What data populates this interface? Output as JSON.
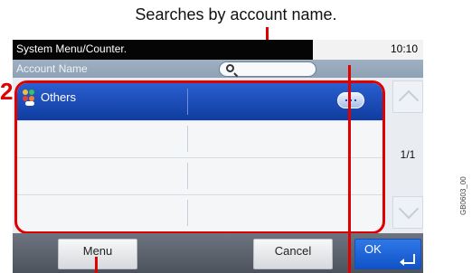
{
  "caption": "Searches by account name.",
  "window": {
    "title": "System Menu/Counter.",
    "time": "10:10",
    "header_label": "Account Name"
  },
  "search": {
    "placeholder": ""
  },
  "step_number": "2",
  "rows": [
    {
      "name": "Others",
      "selected": true,
      "has_more_button": true
    },
    {
      "name": "",
      "selected": false
    },
    {
      "name": "",
      "selected": false
    },
    {
      "name": "",
      "selected": false
    }
  ],
  "pager": {
    "label": "1/1"
  },
  "footer": {
    "menu_label": "Menu",
    "cancel_label": "Cancel",
    "ok_label": "OK"
  },
  "figure_ref": "GB0603_00",
  "colors": {
    "selected_row": "#1f4fc0",
    "callout_red": "#e00000",
    "ok_button": "#1b62d8"
  }
}
